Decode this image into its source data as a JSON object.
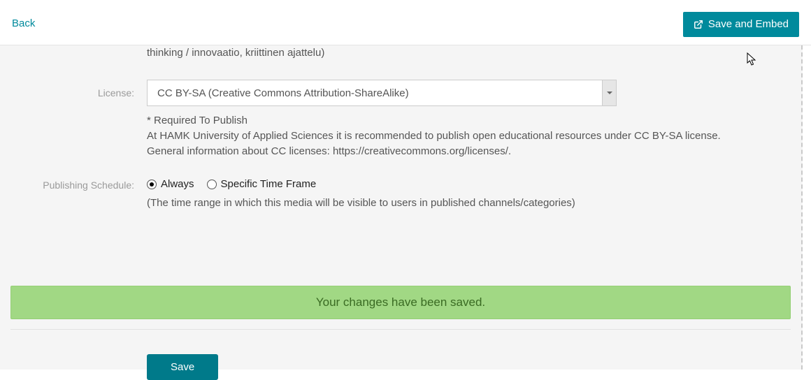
{
  "header": {
    "back_label": "Back",
    "save_embed_label": "Save and Embed"
  },
  "cutoff": {
    "text": "thinking / innovaatio, kriittinen ajattelu)"
  },
  "license": {
    "label": "License:",
    "selected": "CC BY-SA (Creative Commons Attribution-ShareAlike)",
    "required_note": "* Required To Publish",
    "help": "At HAMK University of Applied Sciences it is recommended to publish open educational resources under CC BY-SA license. General information about CC licenses: https://creativecommons.org/licenses/."
  },
  "schedule": {
    "label": "Publishing Schedule:",
    "options": {
      "always": "Always",
      "specific": "Specific Time Frame"
    },
    "help": "(The time range in which this media will be visible to users in published channels/categories)"
  },
  "banner": {
    "message": "Your changes have been saved."
  },
  "footer": {
    "save_label": "Save"
  }
}
